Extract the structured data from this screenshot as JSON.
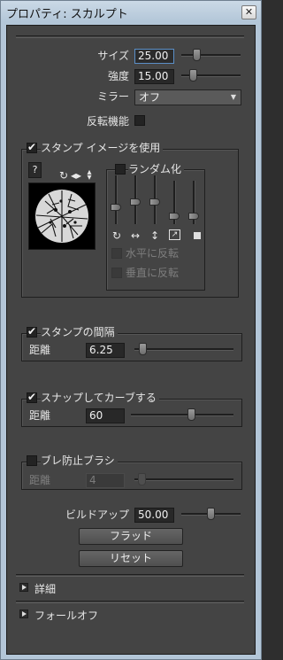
{
  "window": {
    "title": "プロパティ: スカルプト",
    "close_glyph": "✕"
  },
  "brush": {
    "size_label": "サイズ",
    "size_value": "25.00",
    "size_level": 0.22,
    "strength_label": "強度",
    "strength_value": "15.00",
    "strength_level": 0.15,
    "mirror_label": "ミラー",
    "mirror_value": "オフ",
    "invert_label": "反転機能"
  },
  "stamp": {
    "use_label": "スタンプ イメージを使用",
    "random_label": "ランダム化",
    "flip_h_label": "水平に反転",
    "flip_v_label": "垂直に反転",
    "help_glyph": "?"
  },
  "spacing": {
    "label": "スタンプの間隔",
    "distance_label": "距離",
    "value": "6.25",
    "level": 0.05
  },
  "snap": {
    "label": "スナップしてカーブする",
    "distance_label": "距離",
    "value": "60",
    "level": 0.6
  },
  "stabilize": {
    "label": "ブレ防止ブラシ",
    "distance_label": "距離",
    "value": "4",
    "level": 0.04
  },
  "buildup": {
    "label": "ビルドアップ",
    "value": "50.00",
    "level": 0.5
  },
  "buttons": {
    "flood": "フラッド",
    "reset": "リセット"
  },
  "sections": {
    "details": "詳細",
    "falloff": "フォールオフ"
  },
  "colors": {
    "panel": "#444444",
    "title_bar": "#bfd0e0",
    "accent": "#5b8fc7"
  }
}
